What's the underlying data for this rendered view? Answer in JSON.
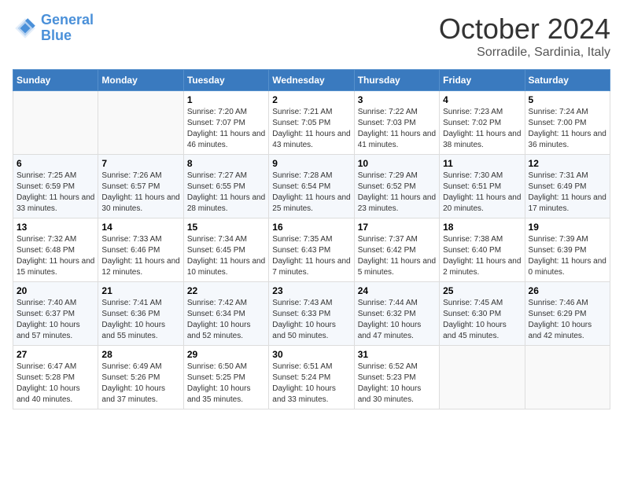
{
  "header": {
    "logo_line1": "General",
    "logo_line2": "Blue",
    "month": "October 2024",
    "location": "Sorradile, Sardinia, Italy"
  },
  "weekdays": [
    "Sunday",
    "Monday",
    "Tuesday",
    "Wednesday",
    "Thursday",
    "Friday",
    "Saturday"
  ],
  "weeks": [
    [
      {
        "day": "",
        "info": ""
      },
      {
        "day": "",
        "info": ""
      },
      {
        "day": "1",
        "info": "Sunrise: 7:20 AM\nSunset: 7:07 PM\nDaylight: 11 hours and 46 minutes."
      },
      {
        "day": "2",
        "info": "Sunrise: 7:21 AM\nSunset: 7:05 PM\nDaylight: 11 hours and 43 minutes."
      },
      {
        "day": "3",
        "info": "Sunrise: 7:22 AM\nSunset: 7:03 PM\nDaylight: 11 hours and 41 minutes."
      },
      {
        "day": "4",
        "info": "Sunrise: 7:23 AM\nSunset: 7:02 PM\nDaylight: 11 hours and 38 minutes."
      },
      {
        "day": "5",
        "info": "Sunrise: 7:24 AM\nSunset: 7:00 PM\nDaylight: 11 hours and 36 minutes."
      }
    ],
    [
      {
        "day": "6",
        "info": "Sunrise: 7:25 AM\nSunset: 6:59 PM\nDaylight: 11 hours and 33 minutes."
      },
      {
        "day": "7",
        "info": "Sunrise: 7:26 AM\nSunset: 6:57 PM\nDaylight: 11 hours and 30 minutes."
      },
      {
        "day": "8",
        "info": "Sunrise: 7:27 AM\nSunset: 6:55 PM\nDaylight: 11 hours and 28 minutes."
      },
      {
        "day": "9",
        "info": "Sunrise: 7:28 AM\nSunset: 6:54 PM\nDaylight: 11 hours and 25 minutes."
      },
      {
        "day": "10",
        "info": "Sunrise: 7:29 AM\nSunset: 6:52 PM\nDaylight: 11 hours and 23 minutes."
      },
      {
        "day": "11",
        "info": "Sunrise: 7:30 AM\nSunset: 6:51 PM\nDaylight: 11 hours and 20 minutes."
      },
      {
        "day": "12",
        "info": "Sunrise: 7:31 AM\nSunset: 6:49 PM\nDaylight: 11 hours and 17 minutes."
      }
    ],
    [
      {
        "day": "13",
        "info": "Sunrise: 7:32 AM\nSunset: 6:48 PM\nDaylight: 11 hours and 15 minutes."
      },
      {
        "day": "14",
        "info": "Sunrise: 7:33 AM\nSunset: 6:46 PM\nDaylight: 11 hours and 12 minutes."
      },
      {
        "day": "15",
        "info": "Sunrise: 7:34 AM\nSunset: 6:45 PM\nDaylight: 11 hours and 10 minutes."
      },
      {
        "day": "16",
        "info": "Sunrise: 7:35 AM\nSunset: 6:43 PM\nDaylight: 11 hours and 7 minutes."
      },
      {
        "day": "17",
        "info": "Sunrise: 7:37 AM\nSunset: 6:42 PM\nDaylight: 11 hours and 5 minutes."
      },
      {
        "day": "18",
        "info": "Sunrise: 7:38 AM\nSunset: 6:40 PM\nDaylight: 11 hours and 2 minutes."
      },
      {
        "day": "19",
        "info": "Sunrise: 7:39 AM\nSunset: 6:39 PM\nDaylight: 11 hours and 0 minutes."
      }
    ],
    [
      {
        "day": "20",
        "info": "Sunrise: 7:40 AM\nSunset: 6:37 PM\nDaylight: 10 hours and 57 minutes."
      },
      {
        "day": "21",
        "info": "Sunrise: 7:41 AM\nSunset: 6:36 PM\nDaylight: 10 hours and 55 minutes."
      },
      {
        "day": "22",
        "info": "Sunrise: 7:42 AM\nSunset: 6:34 PM\nDaylight: 10 hours and 52 minutes."
      },
      {
        "day": "23",
        "info": "Sunrise: 7:43 AM\nSunset: 6:33 PM\nDaylight: 10 hours and 50 minutes."
      },
      {
        "day": "24",
        "info": "Sunrise: 7:44 AM\nSunset: 6:32 PM\nDaylight: 10 hours and 47 minutes."
      },
      {
        "day": "25",
        "info": "Sunrise: 7:45 AM\nSunset: 6:30 PM\nDaylight: 10 hours and 45 minutes."
      },
      {
        "day": "26",
        "info": "Sunrise: 7:46 AM\nSunset: 6:29 PM\nDaylight: 10 hours and 42 minutes."
      }
    ],
    [
      {
        "day": "27",
        "info": "Sunrise: 6:47 AM\nSunset: 5:28 PM\nDaylight: 10 hours and 40 minutes."
      },
      {
        "day": "28",
        "info": "Sunrise: 6:49 AM\nSunset: 5:26 PM\nDaylight: 10 hours and 37 minutes."
      },
      {
        "day": "29",
        "info": "Sunrise: 6:50 AM\nSunset: 5:25 PM\nDaylight: 10 hours and 35 minutes."
      },
      {
        "day": "30",
        "info": "Sunrise: 6:51 AM\nSunset: 5:24 PM\nDaylight: 10 hours and 33 minutes."
      },
      {
        "day": "31",
        "info": "Sunrise: 6:52 AM\nSunset: 5:23 PM\nDaylight: 10 hours and 30 minutes."
      },
      {
        "day": "",
        "info": ""
      },
      {
        "day": "",
        "info": ""
      }
    ]
  ]
}
